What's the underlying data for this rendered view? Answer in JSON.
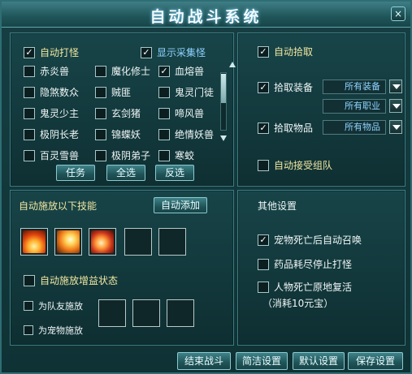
{
  "window": {
    "title": "自动战斗系统",
    "close_icon": "×"
  },
  "monsters": {
    "auto_attack_label": "自动打怪",
    "show_collect_label": "显示采集怪",
    "list": [
      [
        "赤炎兽",
        "魔化修士",
        "血熔兽"
      ],
      [
        "隐煞数众",
        "贼匪",
        "鬼灵门徒"
      ],
      [
        "鬼灵少主",
        "玄剑猪",
        "啼风兽"
      ],
      [
        "极阴长老",
        "锦蝶妖",
        "绝情妖兽"
      ],
      [
        "百灵雪兽",
        "极阴弟子",
        "寒蛟"
      ]
    ],
    "checked": [
      [
        false,
        false,
        true
      ],
      [
        false,
        false,
        false
      ],
      [
        false,
        false,
        false
      ],
      [
        false,
        false,
        false
      ],
      [
        false,
        false,
        false
      ]
    ],
    "buttons": {
      "task": "任务",
      "select_all": "全选",
      "invert": "反选"
    }
  },
  "pickup": {
    "auto_pickup_label": "自动拾取",
    "equip_label": "拾取装备",
    "equip_select_1": "所有装备",
    "equip_select_2": "所有职业",
    "item_label": "拾取物品",
    "item_select": "所有物品",
    "auto_team_label": "自动接受组队"
  },
  "skills": {
    "title": "自动施放以下技能",
    "auto_add_button": "自动添加",
    "buff_label": "自动施放增益状态",
    "team_cast_label": "为队友施放",
    "pet_cast_label": "为宠物施放"
  },
  "other": {
    "title": "其他设置",
    "pet_revive_label": "宠物死亡后自动召唤",
    "potion_stop_label": "药品耗尽停止打怪",
    "revive_label": "人物死亡原地复活",
    "revive_cost": "（消耗10元宝）"
  },
  "footer": {
    "end_battle": "结束战斗",
    "simple_settings": "简洁设置",
    "default_settings": "默认设置",
    "save_settings": "保存设置"
  }
}
